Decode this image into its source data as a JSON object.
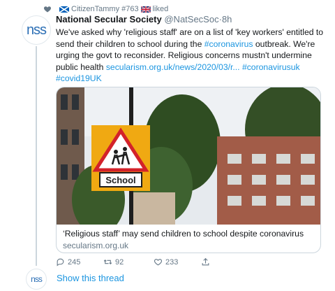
{
  "social_context": {
    "icon": "heart-icon",
    "user": "CitizenTammy #763",
    "action": "liked",
    "flag_before": "scotland-flag",
    "flag_after": "uk-flag"
  },
  "tweet": {
    "avatar_text": "nss",
    "author_name": "National Secular Society",
    "author_handle": "@NatSecSoc",
    "separator": "·",
    "time": "8h",
    "text_part1": "We've asked why 'religious staff' are on a list of 'key workers' entitled to send their children to school during the ",
    "hashtag1": "#coronavirus",
    "text_part2": " outbreak. We're urging the govt to reconsider. Religious concerns mustn't undermine public health ",
    "link": "secularism.org.uk/news/2020/03/r...",
    "hashtag2": "#coronavirusuk",
    "hashtag3": "#covid19UK"
  },
  "card": {
    "sign_text": "School",
    "title": "‘Religious staff’ may send children to school despite coronavirus",
    "domain": "secularism.org.uk"
  },
  "actions": {
    "reply_count": "245",
    "retweet_count": "92",
    "like_count": "233",
    "reply_icon": "reply-icon",
    "retweet_icon": "retweet-icon",
    "like_icon": "like-icon",
    "share_icon": "share-icon"
  },
  "thread": {
    "avatar_text": "nss",
    "show_thread_label": "Show this thread"
  },
  "colors": {
    "link": "#1b95e0",
    "muted": "#657786",
    "text": "#14171a",
    "brand": "#2c6fb5"
  }
}
